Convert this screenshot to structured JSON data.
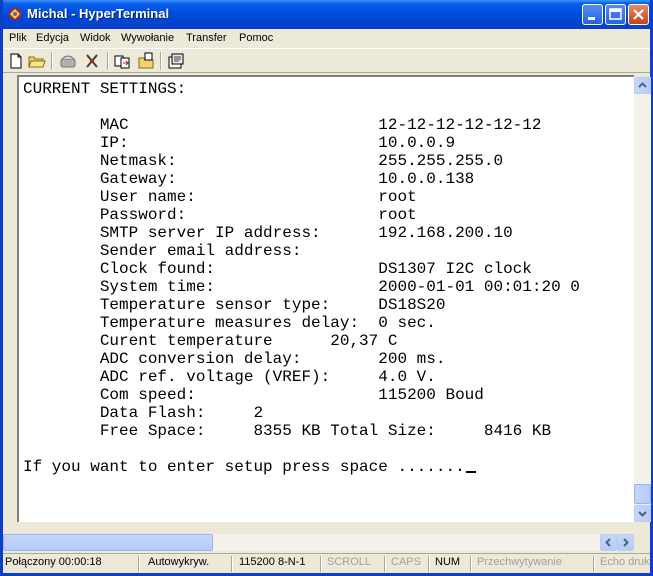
{
  "window": {
    "title": "Michal - HyperTerminal",
    "buttons": {
      "minimize": "_",
      "maximize": "□",
      "close": "✕"
    }
  },
  "menu": [
    "Plik",
    "Edycja",
    "Widok",
    "Wywołanie",
    "Transfer",
    "Pomoc"
  ],
  "toolbar": {
    "icons": [
      "new-icon",
      "open-icon",
      "dial-icon",
      "disconnect-icon",
      "send-icon",
      "receive-icon",
      "properties-icon"
    ]
  },
  "terminal": {
    "lines": [
      "CURRENT SETTINGS:",
      "",
      "        MAC                          12-12-12-12-12-12",
      "        IP:                          10.0.0.9",
      "        Netmask:                     255.255.255.0",
      "        Gateway:                     10.0.0.138",
      "        User name:                   root",
      "        Password:                    root",
      "        SMTP server IP address:      192.168.200.10",
      "        Sender email address:",
      "        Clock found:                 DS1307 I2C clock",
      "        System time:                 2000-01-01 00:01:20 0",
      "        Temperature sensor type:     DS18S20",
      "        Temperature measures delay:  0 sec.",
      "        Curent temperature      20,37 C",
      "        ADC conversion delay:        200 ms.",
      "        ADC ref. voltage (VREF):     4.0 V.",
      "        Com speed:                   115200 Boud",
      "        Data Flash:     2",
      "        Free Space:     8355 KB Total Size:     8416 KB",
      "",
      "If you want to enter setup press space ......."
    ]
  },
  "statusbar": {
    "connected": "Połączony 00:00:18",
    "detect": "Autowykryw.",
    "port_settings": "115200 8-N-1",
    "scroll": "SCROLL",
    "caps": "CAPS",
    "num": "NUM",
    "capture": "Przechwytywanie",
    "echo": "Echo druk"
  },
  "colors": {
    "titlebar": "#0A5FE8",
    "chrome": "#ECE9D8",
    "terminal_bg": "#FFFFFF",
    "terminal_fg": "#000000"
  }
}
